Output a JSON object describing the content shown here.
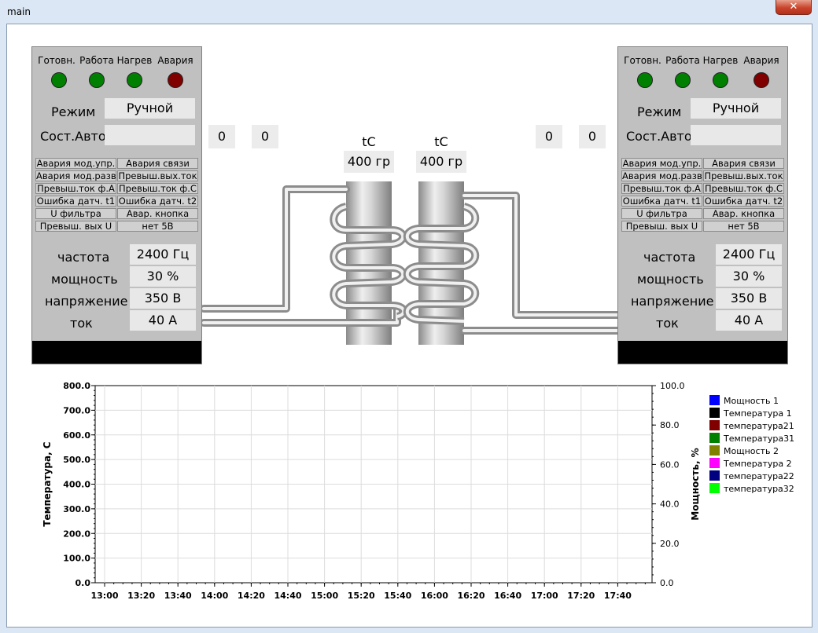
{
  "window": {
    "title": "main",
    "close_glyph": "✕"
  },
  "panel_left": {
    "lamps": [
      {
        "label": "Готовн.",
        "state": "on",
        "color": "#008000"
      },
      {
        "label": "Работа",
        "state": "on",
        "color": "#008000"
      },
      {
        "label": "Нагрев",
        "state": "on",
        "color": "#008000"
      },
      {
        "label": "Авария",
        "state": "alarm",
        "color": "#800000"
      }
    ],
    "mode_label": "Режим",
    "mode_value": "Ручной",
    "auto_label": "Сост.Авто",
    "auto_value": "",
    "alarms": [
      "Авария мод.упр.",
      "Авария связи",
      "Авария мод.разв",
      "Превыш.вых.ток",
      "Превыш.ток ф.А",
      "Превыш.ток ф.С",
      "Ошибка датч. t1",
      "Ошибка датч. t2",
      "U фильтра",
      "Авар. кнопка",
      "Превыш. вых U",
      "нет 5В"
    ],
    "params": [
      {
        "label": "частота",
        "value": "2400 Гц"
      },
      {
        "label": "мощность",
        "value": "30 %"
      },
      {
        "label": "напряжение",
        "value": "350 В"
      },
      {
        "label": "ток",
        "value": "40 А"
      }
    ],
    "counters": [
      "0",
      "0"
    ]
  },
  "panel_right": {
    "lamps": [
      {
        "label": "Готовн.",
        "state": "on",
        "color": "#008000"
      },
      {
        "label": "Работа",
        "state": "on",
        "color": "#008000"
      },
      {
        "label": "Нагрев",
        "state": "on",
        "color": "#008000"
      },
      {
        "label": "Авария",
        "state": "alarm",
        "color": "#800000"
      }
    ],
    "mode_label": "Режим",
    "mode_value": "Ручной",
    "auto_label": "Сост.Авто",
    "auto_value": "",
    "alarms": [
      "Авария мод.упр.",
      "Авария связи",
      "Авария мод.разв",
      "Превыш.вых.ток",
      "Превыш.ток ф.А",
      "Превыш.ток ф.С",
      "Ошибка датч. t1",
      "Ошибка датч. t2",
      "U фильтра",
      "Авар. кнопка",
      "Превыш. вых U",
      "нет 5В"
    ],
    "params": [
      {
        "label": "частота",
        "value": "2400 Гц"
      },
      {
        "label": "мощность",
        "value": "30 %"
      },
      {
        "label": "напряжение",
        "value": "350 В"
      },
      {
        "label": "ток",
        "value": "40 А"
      }
    ],
    "counters": [
      "0",
      "0"
    ]
  },
  "coils": [
    {
      "label": "tC",
      "value": "400 гр"
    },
    {
      "label": "tC",
      "value": "400 гр"
    }
  ],
  "chart_data": {
    "type": "line",
    "title": "",
    "ylabel": "Температура, С",
    "y2label": "Мощность, %",
    "ylim": [
      0,
      800
    ],
    "y2lim": [
      0,
      100
    ],
    "yticks": [
      "0.0",
      "100.0",
      "200.0",
      "300.0",
      "400.0",
      "500.0",
      "600.0",
      "700.0",
      "800.0"
    ],
    "y2ticks": [
      "0.0",
      "20.0",
      "40.0",
      "60.0",
      "80.0",
      "100.0"
    ],
    "xticks": [
      "13:00",
      "13:20",
      "13:40",
      "14:00",
      "14:20",
      "14:40",
      "15:00",
      "15:20",
      "15:40",
      "16:00",
      "16:20",
      "16:40",
      "17:00",
      "17:20",
      "17:40"
    ],
    "grid": true,
    "legend_position": "right",
    "series": [
      {
        "name": "Мощность 1",
        "color": "#0000ff",
        "values": []
      },
      {
        "name": "Температура 1",
        "color": "#000000",
        "values": []
      },
      {
        "name": "температура21",
        "color": "#800000",
        "values": []
      },
      {
        "name": "Температура31",
        "color": "#008000",
        "values": []
      },
      {
        "name": "Мощность 2",
        "color": "#808000",
        "values": []
      },
      {
        "name": "Температура 2",
        "color": "#ff00ff",
        "values": []
      },
      {
        "name": "температура22",
        "color": "#000080",
        "values": []
      },
      {
        "name": "температура32",
        "color": "#00ff00",
        "values": []
      }
    ]
  }
}
